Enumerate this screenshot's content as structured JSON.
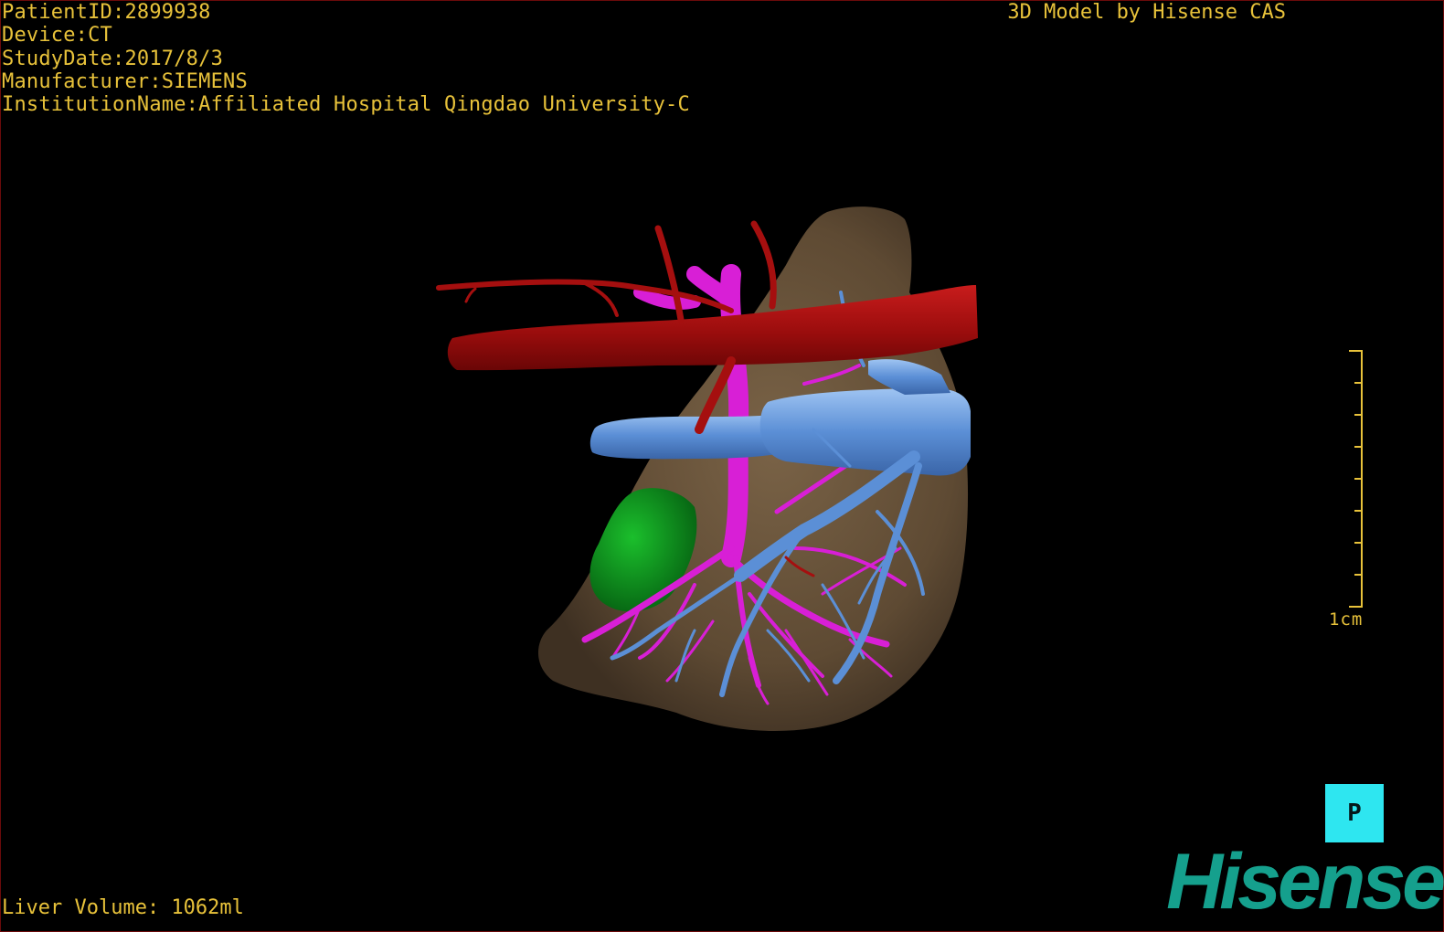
{
  "header": {
    "patient_id": "PatientID:2899938",
    "device": "Device:CT",
    "study_date": "StudyDate:2017/8/3",
    "manufacturer": "Manufacturer:SIEMENS",
    "institution": "InstitutionName:Affiliated Hospital Qingdao University-C"
  },
  "credit": "3D Model by Hisense CAS",
  "footer": {
    "liver_volume": "Liver Volume: 1062ml"
  },
  "scale": {
    "label": "1cm"
  },
  "orientation": {
    "label": "P"
  },
  "logo": {
    "text": "Hisense"
  },
  "colors": {
    "overlay_text": "#e8c23a",
    "liver": "#5e4a33",
    "artery": "#a50f0f",
    "hepatic_vein": "#5b8fd6",
    "portal_vein": "#d81fd6",
    "gallbladder": "#0c8c1a",
    "orientation_button": "#2ee6f0",
    "logo": "#15a08d"
  },
  "icons": {
    "orientation": "orientation-cube-icon"
  }
}
